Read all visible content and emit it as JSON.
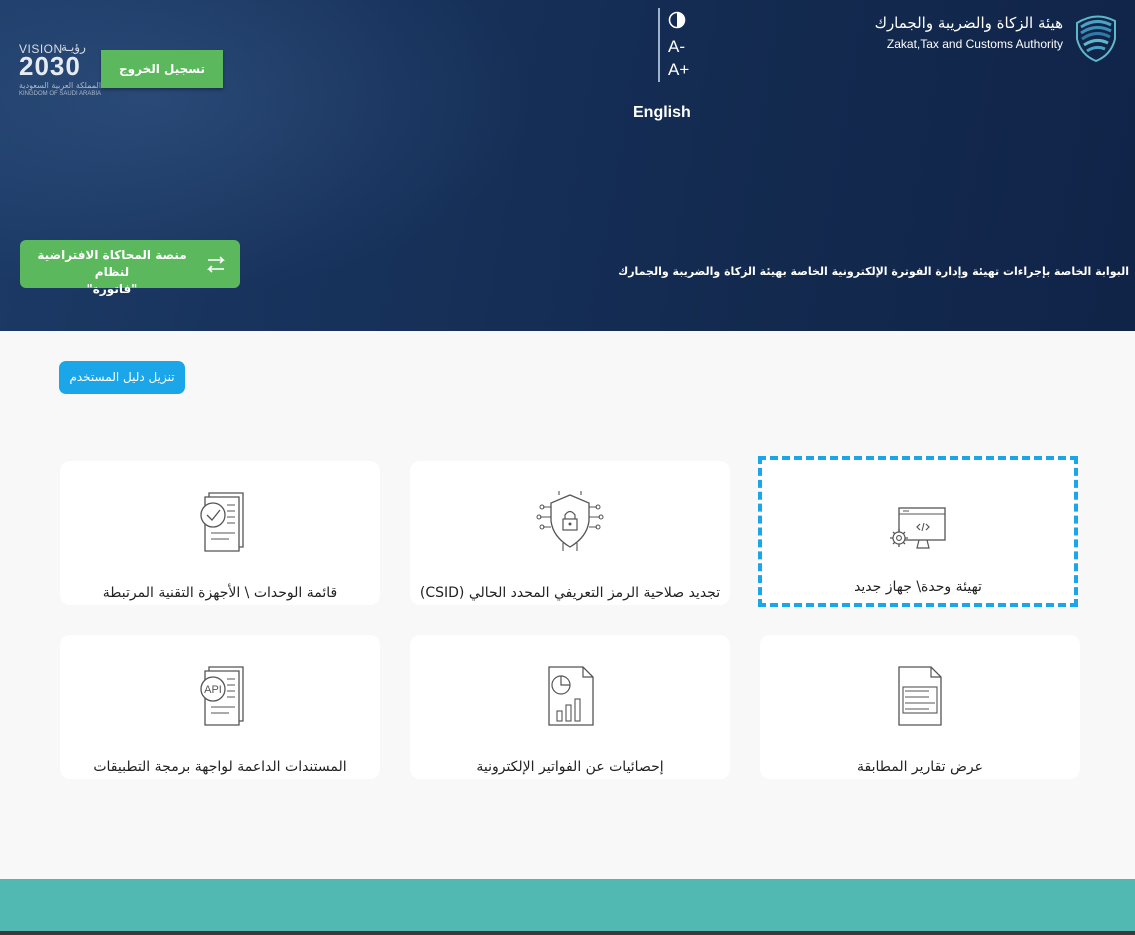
{
  "header": {
    "logo_ar": "هيئة الزكاة والضريبة والجمارك",
    "logo_en": "Zakat,Tax and Customs Authority",
    "contrast_icon": "contrast-icon",
    "font_decrease": "A-",
    "font_increase": "A+",
    "language": "English",
    "logout_label": "تسجيل الخروج",
    "vision": {
      "title": "VISION",
      "title_ar": "رؤيـة",
      "year": "2030",
      "country_ar": "المملكة العربية السعودية",
      "country_en": "KINGDOM OF SAUDI ARABIA"
    },
    "simulation_label_line1": "منصة المحاكاة الافتراضية لنظام",
    "simulation_label_line2": "\"فاتورة\"",
    "portal_description": "البوابة الخاصة بإجراءات تهيئة وإدارة الفوترة الإلكترونية الخاصة بهيئة الزكاة والضريبة والجمارك"
  },
  "main": {
    "guide_label": "تنزيل دليل المستخدم",
    "cards": [
      {
        "label": "تهيئة وحدة\\ جهاز جديد",
        "icon": "monitor-code-icon"
      },
      {
        "label": "تجديد صلاحية الرمز التعريفي المحدد الحالي (CSID)",
        "icon": "shield-lock-icon"
      },
      {
        "label": "قائمة الوحدات \\ الأجهزة التقنية المرتبطة",
        "icon": "document-check-icon"
      },
      {
        "label": "عرض تقارير المطابقة",
        "icon": "report-document-icon"
      },
      {
        "label": "إحصائيات عن الفواتير الإلكترونية",
        "icon": "statistics-document-icon"
      },
      {
        "label": "المستندات الداعمة لواجهة برمجة التطبيقات",
        "icon": "api-document-icon",
        "icon_text": "API"
      }
    ]
  },
  "colors": {
    "header_bg": "#16315a",
    "green": "#5cb85c",
    "blue": "#1aa6e8",
    "teal_footer": "#52b8b2"
  }
}
